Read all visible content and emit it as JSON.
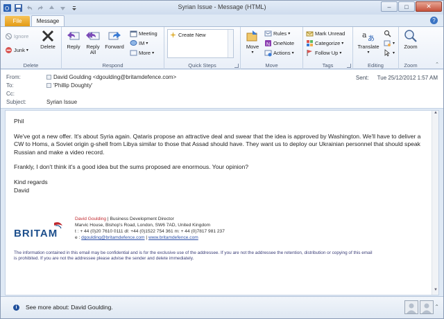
{
  "window": {
    "title": "Syrian Issue  -  Message (HTML)",
    "controls": {
      "minimize": "–",
      "maximize": "□",
      "close": "✕"
    }
  },
  "tabs": {
    "file": "File",
    "message": "Message"
  },
  "ribbon": {
    "delete_group": {
      "label": "Delete",
      "ignore": "Ignore",
      "junk": "Junk",
      "delete": "Delete"
    },
    "respond_group": {
      "label": "Respond",
      "reply": "Reply",
      "reply_all": "Reply All",
      "forward": "Forward",
      "meeting": "Meeting",
      "im": "IM",
      "more": "More"
    },
    "quick_steps_group": {
      "label": "Quick Steps",
      "create_new": "Create New"
    },
    "move_group": {
      "label": "Move",
      "move": "Move",
      "rules": "Rules",
      "onenote": "OneNote",
      "actions": "Actions"
    },
    "tags_group": {
      "label": "Tags",
      "mark_unread": "Mark Unread",
      "categorize": "Categorize",
      "follow_up": "Follow Up"
    },
    "editing_group": {
      "label": "Editing",
      "translate": "Translate"
    },
    "zoom_group": {
      "label": "Zoom",
      "zoom": "Zoom"
    }
  },
  "header": {
    "from_label": "From:",
    "from_value": "David Goulding <dgoulding@britamdefence.com>",
    "to_label": "To:",
    "to_value": "'Phillip Doughty'",
    "cc_label": "Cc:",
    "cc_value": "",
    "subject_label": "Subject:",
    "subject_value": "Syrian Issue",
    "sent_label": "Sent:",
    "sent_value": "Tue 25/12/2012 1:57 AM"
  },
  "body": {
    "greeting": "Phil",
    "para1": "We've got a new offer.  It's about Syria again. Qataris propose an attractive deal and swear that the idea is approved by Washington. We'll have to deliver a CW to Homs, a Soviet origin g-shell from Libya similar to those that Assad should have. They want us to deploy our Ukrainian personnel that should speak Russian and make a video record.",
    "para2": "Frankly, I don't think it's a good idea but the sums proposed are enormous.  Your opinion?",
    "closing": "Kind regards",
    "signoff": "David"
  },
  "signature": {
    "logo_text": "BRITAM",
    "name": "David Goulding",
    "title": " | Business Development Director",
    "address": "Marvic House, Bishop's Road, London, SW6 7AD, United Kingdom",
    "phones": "t :  + 44 (0)20 7610 0111     dl: +44 (0)1522 754 361     m: + 44 (0)7817 981 237",
    "email_prefix": "e : ",
    "email": "dgoulding@britamdefence.com",
    "separator": " | ",
    "website": "www.britamdefence.com",
    "disclaimer": "The information contained in this email may be confidential and is for the exclusive use of the addressee. If you are not the addressee the retention, distribution or copying of this email is prohibited. If you are not the addressee please advise the sender and delete immediately."
  },
  "people_pane": {
    "text": "See more about: David Goulding.",
    "info_icon": "i"
  },
  "icons": [
    "save-icon",
    "undo-icon",
    "redo-icon",
    "up-icon",
    "down-icon",
    "help-icon",
    "ignore-icon",
    "junk-icon",
    "delete-icon",
    "reply-icon",
    "reply-all-icon",
    "forward-icon",
    "meeting-icon",
    "im-icon",
    "more-icon",
    "create-new-icon",
    "move-icon",
    "rules-icon",
    "onenote-icon",
    "actions-icon",
    "mark-unread-icon",
    "categorize-icon",
    "follow-up-icon",
    "translate-icon",
    "zoom-icon",
    "info-icon",
    "avatar"
  ],
  "colors": {
    "file_tab": "#e39b15",
    "signature_name": "#c0282e",
    "link": "#2b4fa8",
    "logo": "#1d4f8c"
  }
}
